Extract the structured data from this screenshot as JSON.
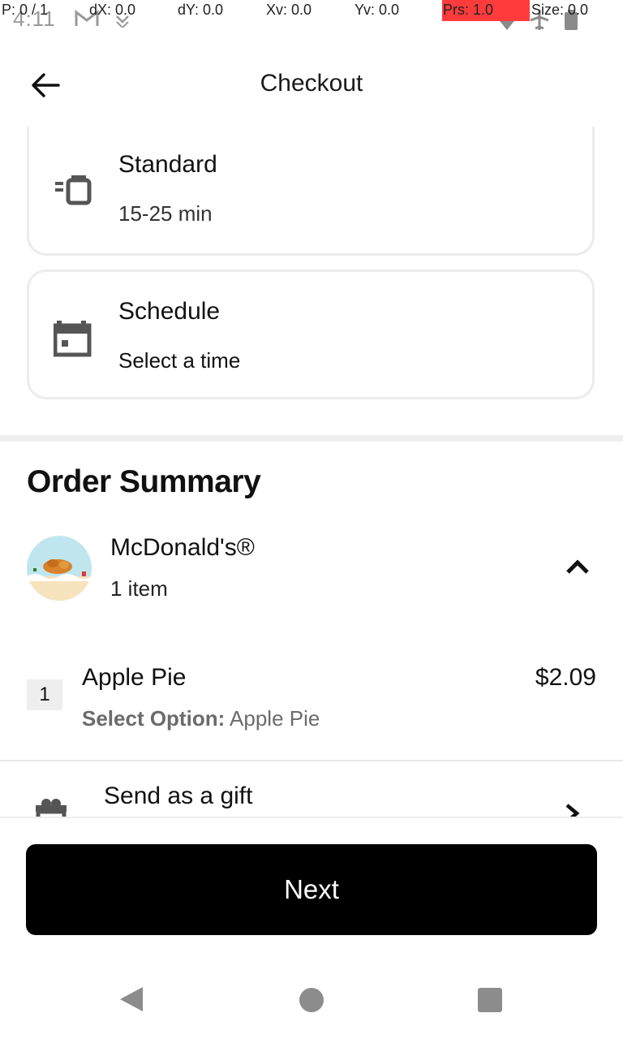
{
  "status_bar": {
    "time": "4:11"
  },
  "debug_overlay": {
    "p": "P: 0 / 1",
    "dx": "dX: 0.0",
    "dy": "dY: 0.0",
    "xv": "Xv: 0.0",
    "yv": "Yv: 0.0",
    "prs": "Prs: 1.0",
    "size": "Size: 0.0"
  },
  "header": {
    "title": "Checkout",
    "back_icon": "arrow-left-icon"
  },
  "delivery_options": [
    {
      "title": "Standard",
      "subtitle": "15-25 min",
      "icon": "delivery-scooter-icon"
    },
    {
      "title": "Schedule",
      "subtitle": "Select a time",
      "icon": "calendar-icon"
    }
  ],
  "order_summary": {
    "heading": "Order Summary",
    "store": {
      "name": "McDonald's®",
      "item_count": "1 item"
    },
    "items": [
      {
        "quantity": "1",
        "name": "Apple Pie",
        "price": "$2.09",
        "option_label": "Select Option:",
        "option_value": " Apple Pie"
      }
    ]
  },
  "gift": {
    "label": "Send as a gift"
  },
  "next_button": {
    "label": "Next"
  },
  "colors": {
    "primary_button": "#000000",
    "card_border": "#ececec",
    "muted_text": "#6b6b6b"
  }
}
